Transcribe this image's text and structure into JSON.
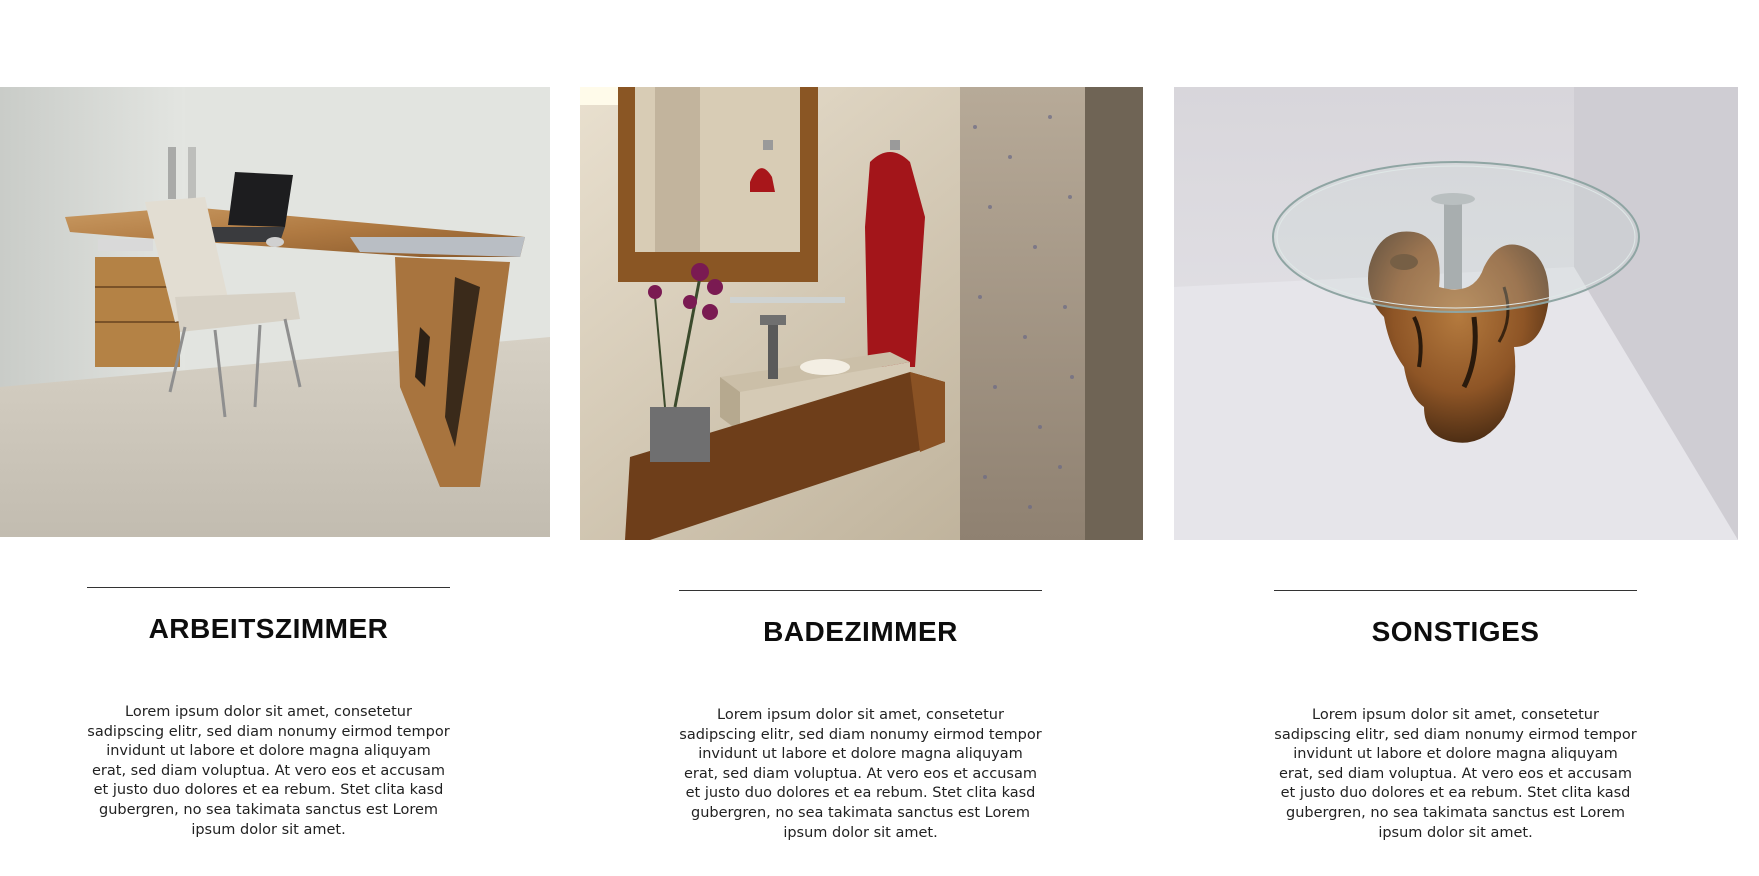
{
  "categories": [
    {
      "title": "ARBEITSZIMMER",
      "image_alt": "Schreibtisch aus Massivholz mit Laptop und Stuhl",
      "text": "Lorem ipsum dolor sit amet, consetetur sadipscing elitr, sed diam nonumy eirmod tempor invidunt ut labore et dolore magna aliquyam erat, sed diam voluptua. At vero eos et accusam et justo duo dolores et ea rebum. Stet clita kasd gubergren, no sea takimata sanctus est Lorem ipsum dolor sit amet."
    },
    {
      "title": "BADEZIMMER",
      "image_alt": "Waschtisch mit Holzunterbau, Spiegel und rotem Handtuch",
      "text": "Lorem ipsum dolor sit amet, consetetur sadipscing elitr, sed diam nonumy eirmod tempor invidunt ut labore et dolore magna aliquyam erat, sed diam voluptua. At vero eos et accusam et justo duo dolores et ea rebum. Stet clita kasd gubergren, no sea takimata sanctus est Lorem ipsum dolor sit amet."
    },
    {
      "title": "SONSTIGES",
      "image_alt": "Runder Glastisch auf Wurzelholzsockel",
      "text": "Lorem ipsum dolor sit amet, consetetur sadipscing elitr, sed diam nonumy eirmod tempor invidunt ut labore et dolore magna aliquyam erat, sed diam voluptua. At vero eos et accusam et justo duo dolores et ea rebum. Stet clita kasd gubergren, no sea takimata sanctus est Lorem ipsum dolor sit amet."
    }
  ],
  "colors": {
    "background": "#ffffff",
    "heading": "#0d0d0d",
    "body_text": "#222222",
    "divider": "#333333"
  }
}
